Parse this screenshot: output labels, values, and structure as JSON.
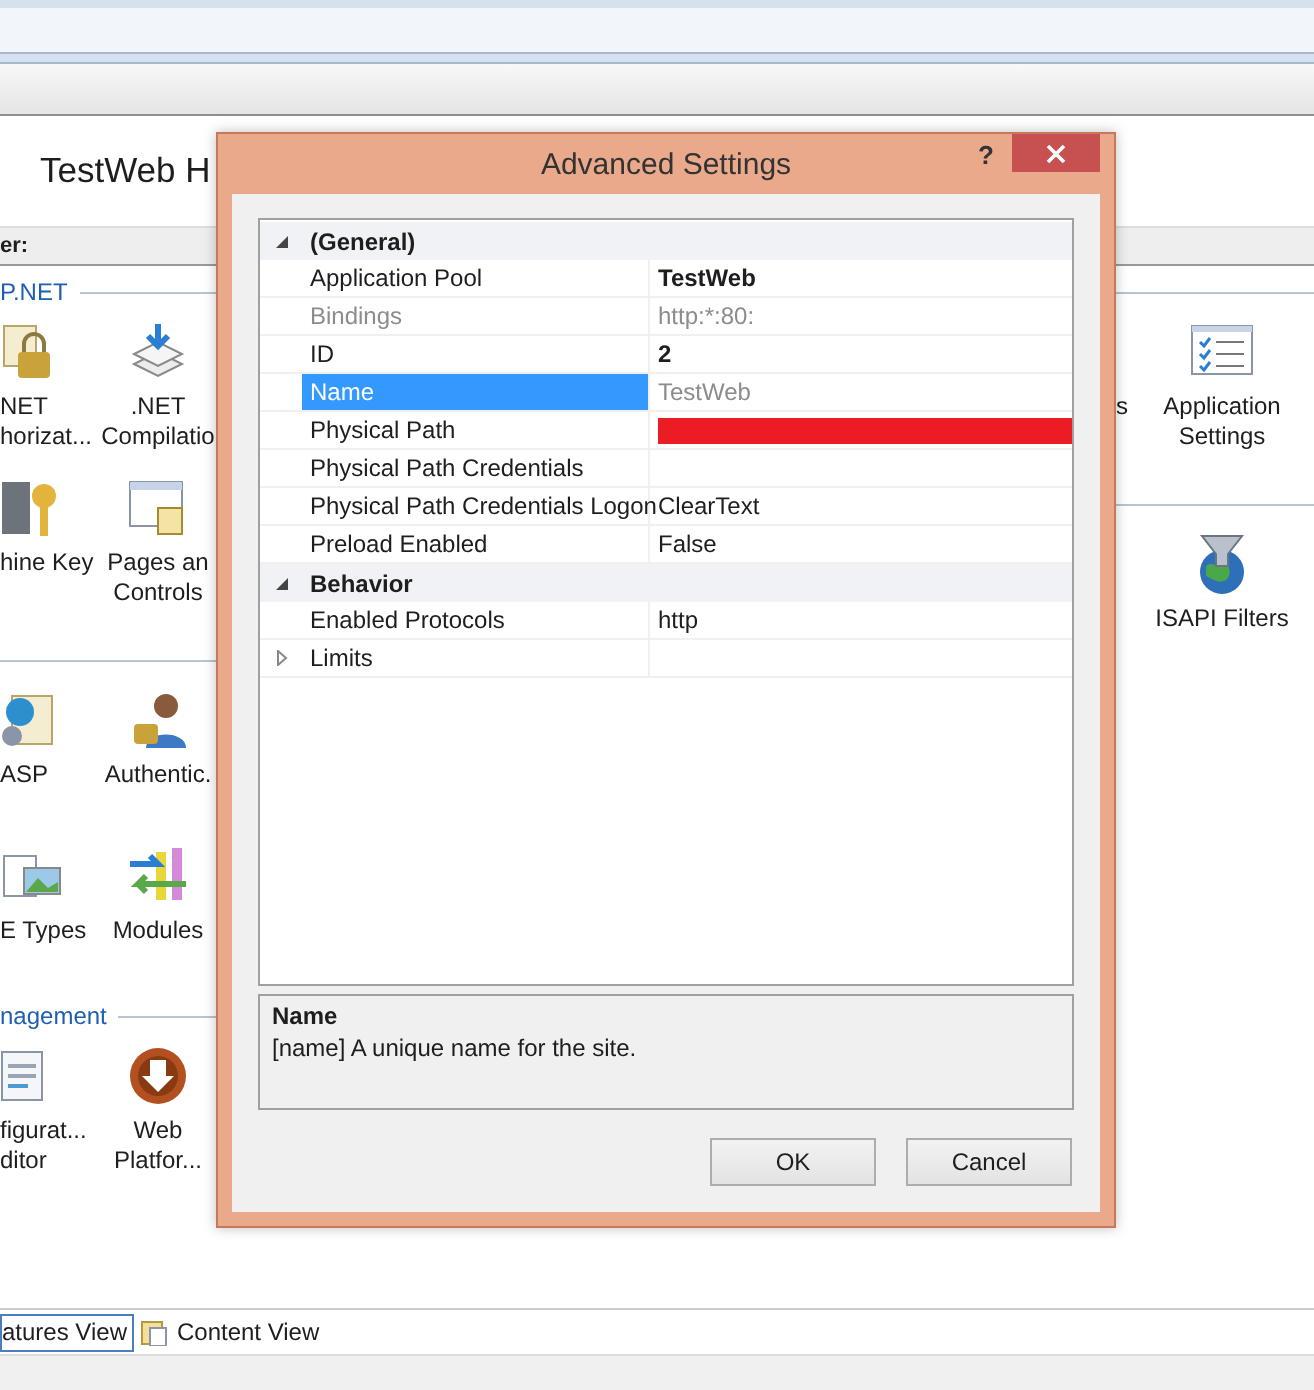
{
  "page": {
    "header": "TestWeb H",
    "filter_label": "er:"
  },
  "left_strip": [
    {
      "title": "P.NET",
      "rows": [
        [
          {
            "lines": [
              "NET",
              "horizat..."
            ]
          },
          {
            "lines": [
              ".NET",
              "Compilatio"
            ]
          }
        ],
        [
          {
            "lines": [
              "hine Key"
            ]
          },
          {
            "lines": [
              "Pages an",
              "Controls"
            ]
          }
        ]
      ]
    },
    {
      "rows": [
        [
          {
            "lines": [
              "ASP"
            ]
          },
          {
            "lines": [
              "Authentic."
            ]
          }
        ],
        [
          {
            "lines": [
              "E Types"
            ]
          },
          {
            "lines": [
              "Modules"
            ]
          }
        ]
      ]
    },
    {
      "title": "nagement",
      "rows": [
        [
          {
            "lines": [
              "figurat...",
              "ditor"
            ]
          },
          {
            "lines": [
              "Web",
              "Platfor..."
            ]
          }
        ]
      ]
    }
  ],
  "right_strip": [
    {
      "rows": [
        [
          {
            "lines": [
              "s"
            ]
          },
          {
            "lines": [
              "Application",
              "Settings"
            ]
          }
        ]
      ]
    },
    {
      "rows": [
        [
          {},
          {
            "lines": [
              "ISAPI Filters"
            ]
          }
        ]
      ]
    }
  ],
  "dialog": {
    "title": "Advanced Settings",
    "help": "?",
    "categories": [
      {
        "name": "(General)",
        "expanded": true,
        "properties": [
          {
            "name": "Application Pool",
            "value": "TestWeb",
            "bold": true,
            "readonly": false,
            "selected": false
          },
          {
            "name": "Bindings",
            "value": "http:*:80:",
            "bold": false,
            "readonly": true,
            "selected": false
          },
          {
            "name": "ID",
            "value": "2",
            "bold": true,
            "readonly": false,
            "selected": false
          },
          {
            "name": "Name",
            "value": "TestWeb",
            "bold": false,
            "readonly": true,
            "selected": true
          },
          {
            "name": "Physical Path",
            "readonly": false,
            "selected": false,
            "redacted": true
          },
          {
            "name": "Physical Path Credentials",
            "readonly": false,
            "selected": false
          },
          {
            "name": "Physical Path Credentials Logon",
            "value": "ClearText",
            "bold": false,
            "readonly": false,
            "selected": false
          },
          {
            "name": "Preload Enabled",
            "value": "False",
            "bold": false,
            "readonly": false,
            "selected": false
          }
        ]
      },
      {
        "name": "Behavior",
        "expanded": true,
        "properties": [
          {
            "name": "Enabled Protocols",
            "value": "http",
            "bold": false,
            "readonly": false,
            "selected": false
          },
          {
            "name": "Limits",
            "expanded": false,
            "readonly": false,
            "selected": false
          }
        ]
      }
    ],
    "description": {
      "title": "Name",
      "text": "[name] A unique name for the site."
    },
    "buttons": [
      "OK",
      "Cancel"
    ]
  },
  "view_tabs": [
    {
      "label": "atures View",
      "selected": true
    },
    {
      "label": "Content View",
      "selected": false
    }
  ]
}
